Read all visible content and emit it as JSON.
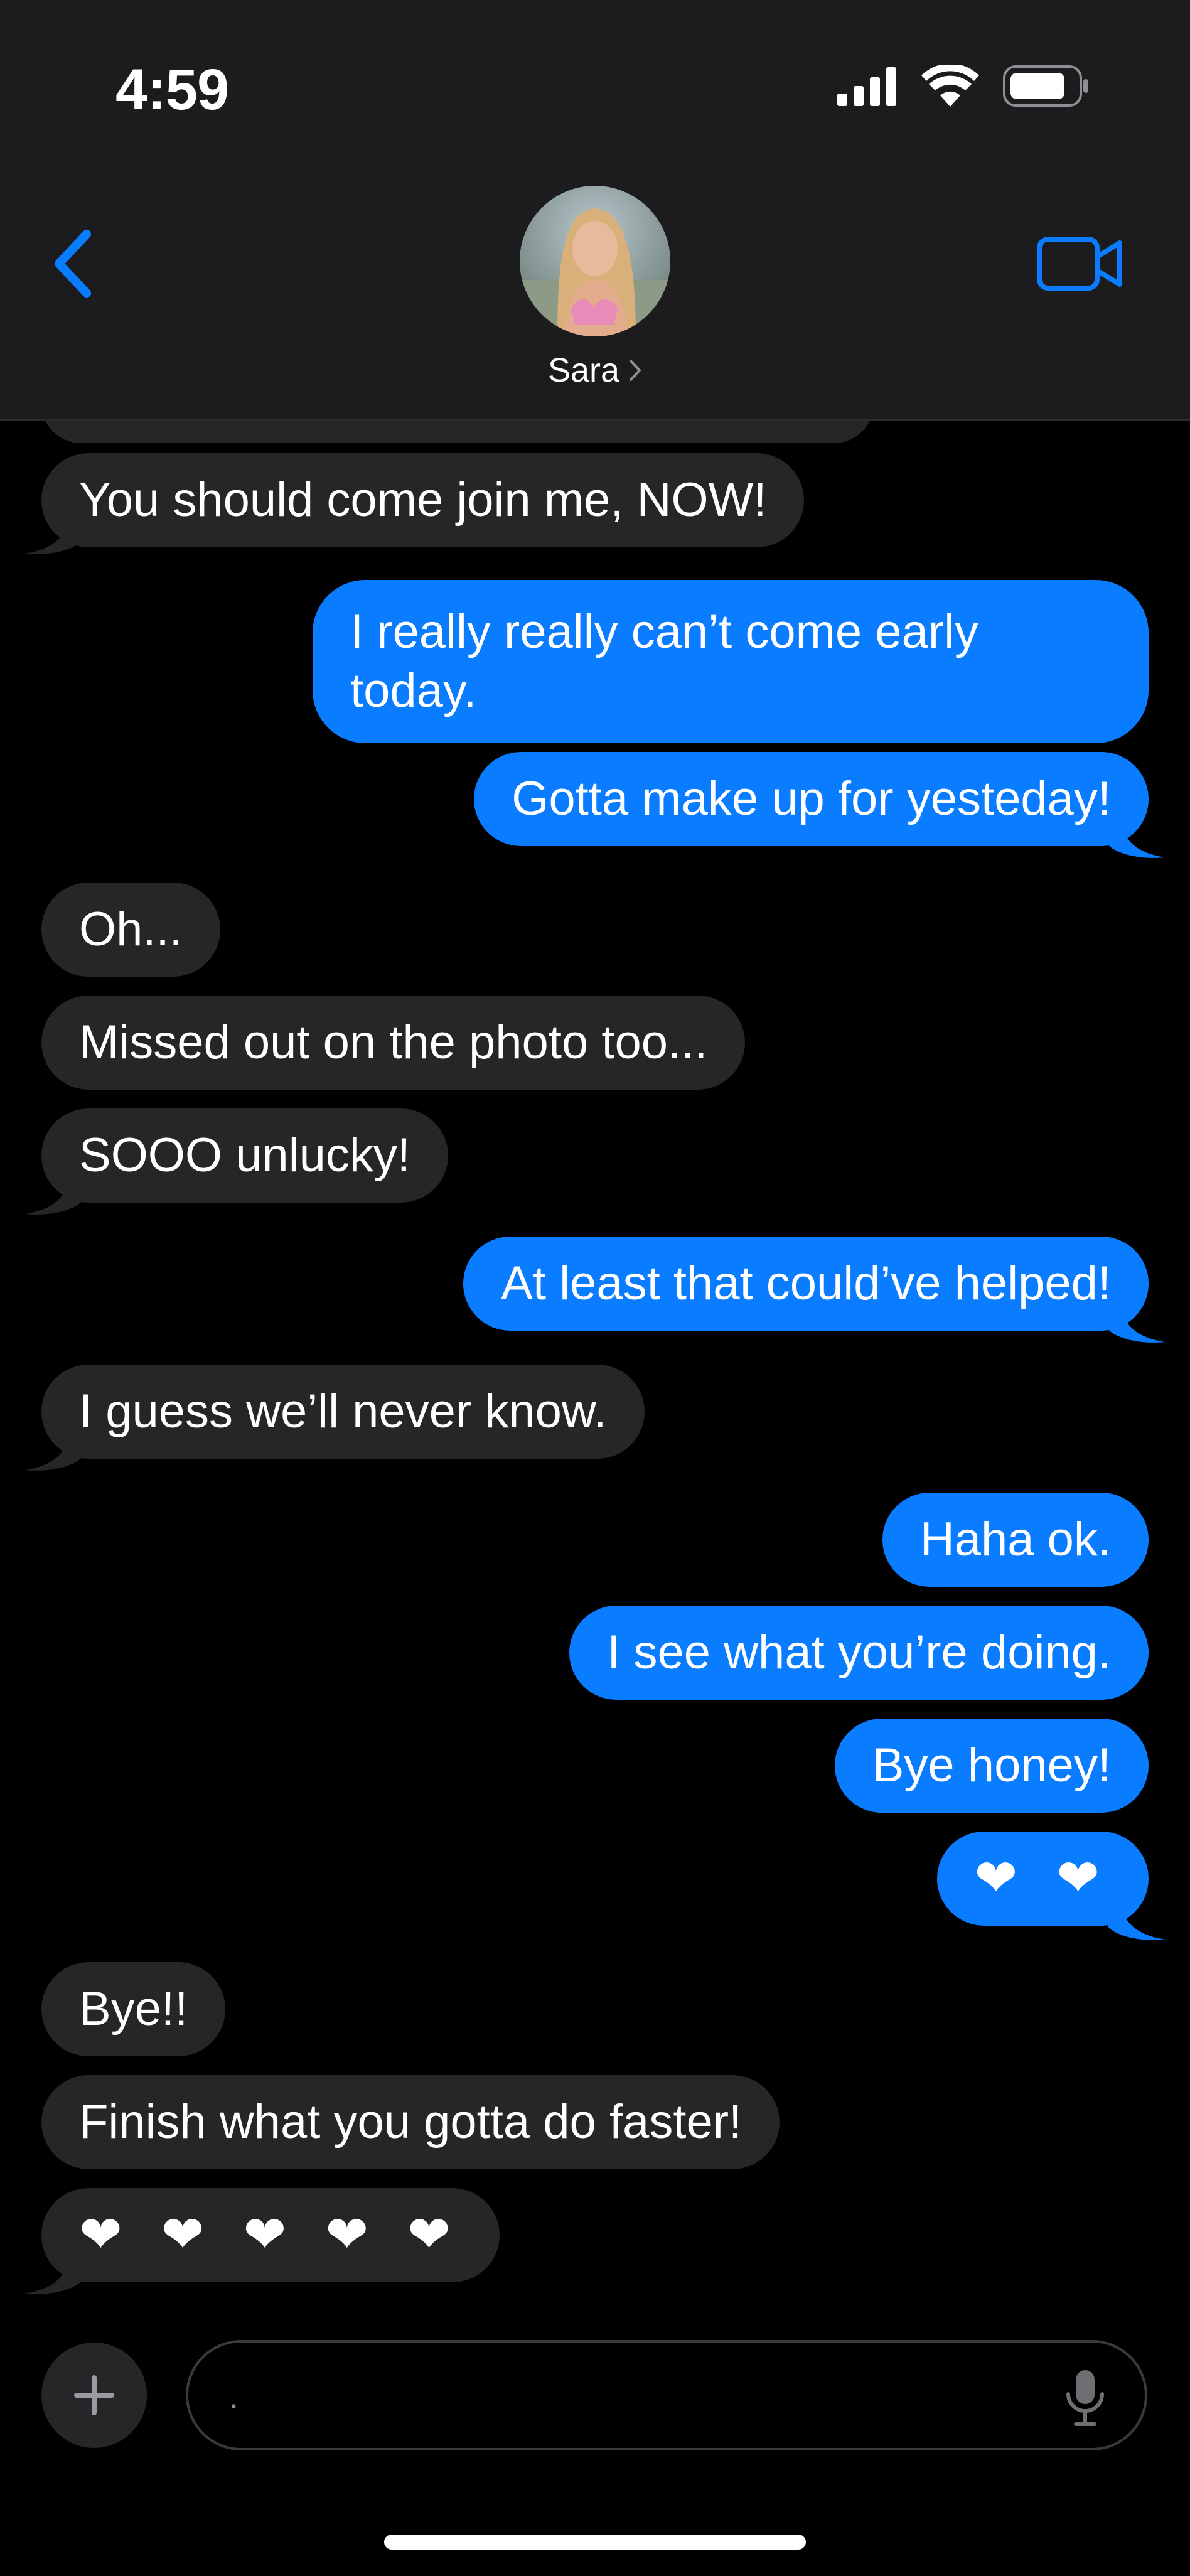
{
  "status_bar": {
    "time": "4:59"
  },
  "header": {
    "contact_name": "Sara",
    "icons": [
      "chevron-left-icon",
      "video-camera-icon",
      "chevron-right-icon"
    ]
  },
  "messages": [
    {
      "direction": "in",
      "text": "You should come join me, NOW!"
    },
    {
      "direction": "out",
      "text": "I really really can’t come early today."
    },
    {
      "direction": "out",
      "text": "Gotta make up for yesteday!"
    },
    {
      "direction": "in",
      "text": "Oh..."
    },
    {
      "direction": "in",
      "text": "Missed out on the photo too..."
    },
    {
      "direction": "in",
      "text": "SOOO unlucky!"
    },
    {
      "direction": "out",
      "text": "At least that could’ve helped!"
    },
    {
      "direction": "in",
      "text": "I guess we’ll never know."
    },
    {
      "direction": "out",
      "text": "Haha ok."
    },
    {
      "direction": "out",
      "text": "I see what you’re doing."
    },
    {
      "direction": "out",
      "text": "Bye honey!"
    },
    {
      "direction": "out",
      "text": "❤ ❤"
    },
    {
      "direction": "in",
      "text": "Bye!!"
    },
    {
      "direction": "in",
      "text": "Finish what you gotta do faster!"
    },
    {
      "direction": "in",
      "text": "❤ ❤ ❤ ❤ ❤"
    }
  ],
  "input": {
    "value": "."
  },
  "colors": {
    "accent": "#0a7cff",
    "incoming_bubble": "#262628",
    "header_bg": "#1c1c1e",
    "heart": "#ff3b6b"
  }
}
